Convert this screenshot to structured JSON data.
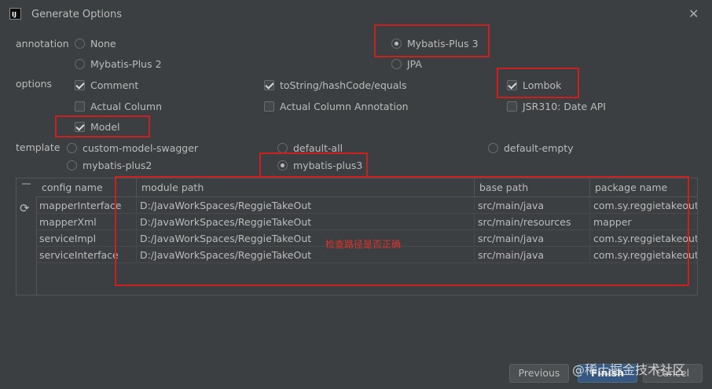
{
  "window": {
    "title": "Generate Options",
    "app_icon_text": "IJ"
  },
  "annotation": {
    "label": "annotation",
    "options": [
      "None",
      "Mybatis-Plus 3",
      "Mybatis-Plus 2",
      "JPA"
    ],
    "selected": "Mybatis-Plus 3"
  },
  "options": {
    "label": "options",
    "items": [
      {
        "label": "Comment",
        "checked": true
      },
      {
        "label": "toString/hashCode/equals",
        "checked": true
      },
      {
        "label": "Lombok",
        "checked": true
      },
      {
        "label": "Actual Column",
        "checked": false
      },
      {
        "label": "Actual Column Annotation",
        "checked": false
      },
      {
        "label": "JSR310: Date API",
        "checked": false
      },
      {
        "label": "Model",
        "checked": true
      }
    ]
  },
  "template": {
    "label": "template",
    "options": [
      "custom-model-swagger",
      "default-all",
      "default-empty",
      "mybatis-plus2",
      "mybatis-plus3"
    ],
    "selected": "mybatis-plus3"
  },
  "table": {
    "columns": [
      "config name",
      "module path",
      "base path",
      "package name"
    ],
    "rows": [
      [
        "mapperInterface",
        "D:/JavaWorkSpaces/ReggieTakeOut",
        "src/main/java",
        "com.sy.reggietakeout.m"
      ],
      [
        "mapperXml",
        "D:/JavaWorkSpaces/ReggieTakeOut",
        "src/main/resources",
        "mapper"
      ],
      [
        "serviceImpl",
        "D:/JavaWorkSpaces/ReggieTakeOut",
        "src/main/java",
        "com.sy.reggietakeout.s"
      ],
      [
        "serviceInterface",
        "D:/JavaWorkSpaces/ReggieTakeOut",
        "src/main/java",
        "com.sy.reggietakeout.s"
      ]
    ],
    "annotation_note": "检查路径是否正确"
  },
  "buttons": {
    "previous": "Previous",
    "finish": "Finish",
    "cancel": "Cancel"
  },
  "watermark": "@稀土掘金技术社区",
  "colors": {
    "background": "#3c3f41",
    "highlight_box": "#cc1f1f",
    "primary_button": "#365880"
  }
}
